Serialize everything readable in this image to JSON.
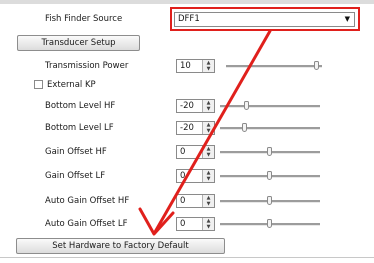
{
  "fish_finder_source": {
    "label": "Fish Finder Source",
    "value": "DFF1"
  },
  "transducer_setup_button": "Transducer Setup",
  "external_kp": {
    "label": "External KP",
    "checked": false
  },
  "controls": [
    {
      "label": "Transmission Power",
      "value": "10",
      "slider_level": 1.0
    },
    {
      "label": "Bottom Level HF",
      "value": "-20",
      "slider_level": 0.3
    },
    {
      "label": "Bottom Level LF",
      "value": "-20",
      "slider_level": 0.3
    },
    {
      "label": "Gain Offset HF",
      "value": "0",
      "slider_level": 0.5
    },
    {
      "label": "Gain Offset LF",
      "value": "0",
      "slider_level": 0.5
    },
    {
      "label": "Auto Gain Offset HF",
      "value": "0",
      "slider_level": 0.5
    },
    {
      "label": "Auto Gain Offset LF",
      "value": "0",
      "slider_level": 0.5
    }
  ],
  "factory_default_button": "Set Hardware to Factory Default",
  "annotation": {
    "color": "#e0201c"
  }
}
